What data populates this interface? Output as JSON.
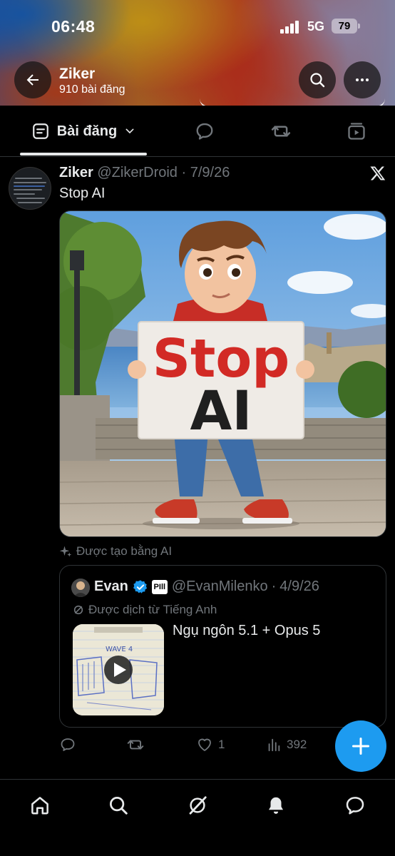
{
  "status_bar": {
    "time": "06:48",
    "network": "5G",
    "battery": "79",
    "battery_level": 0.79
  },
  "profile": {
    "name": "Ziker",
    "post_count": "910 bài đăng"
  },
  "tabs": {
    "posts_label": "Bài đăng",
    "icons": [
      "posts-icon",
      "replies-icon",
      "reposts-icon",
      "media-icon"
    ]
  },
  "post": {
    "author_name": "Ziker",
    "author_handle": "@ZikerDroid",
    "separator": "·",
    "date": "7/9/26",
    "text": "Stop AI",
    "image_sign_line1": "Stop",
    "image_sign_line2": "AI",
    "ai_note": "Được tạo bằng AI"
  },
  "quote": {
    "author_name": "Evan",
    "affiliate_badge": "PIll",
    "author_handle": "@EvanMilenko",
    "separator": "·",
    "date": "4/9/26",
    "translated_note": "Được dịch từ Tiếng Anh",
    "text": "Ngụ ngôn 5.1 + Opus 5",
    "thumb_caption": "WAVE 4"
  },
  "actions": {
    "likes": "1",
    "views": "392"
  },
  "colors": {
    "accent": "#1d9bf0",
    "muted": "#71767b",
    "text": "#e7e9ea",
    "sign_red": "#d22a25"
  },
  "bottom_nav": [
    "home-icon",
    "search-icon",
    "grok-icon",
    "notifications-icon",
    "messages-icon"
  ]
}
